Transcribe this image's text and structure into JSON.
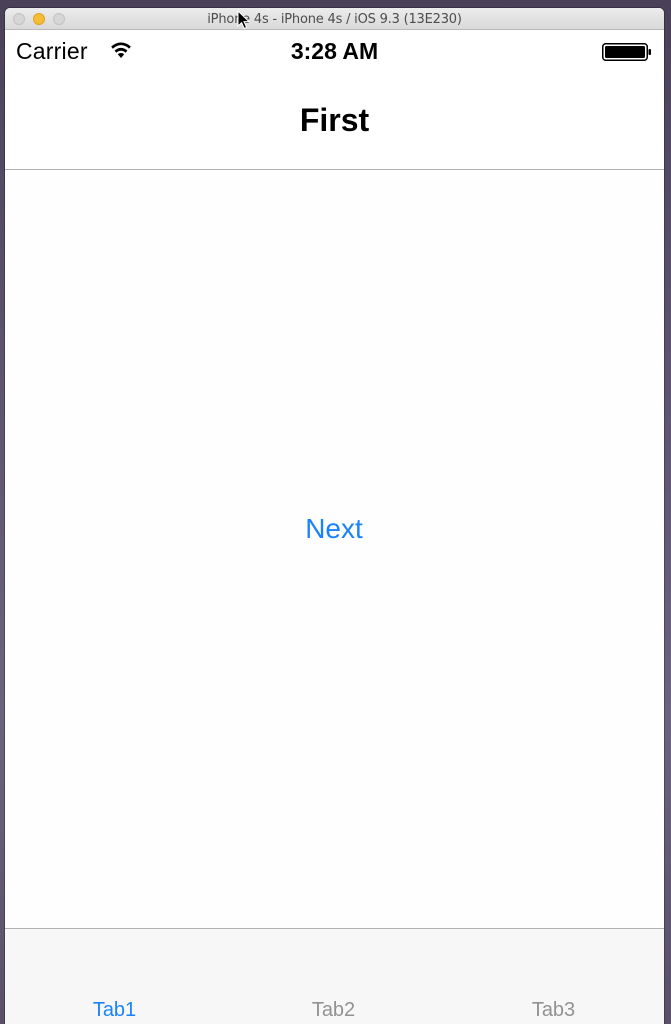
{
  "window": {
    "title": "iPhone 4s - iPhone 4s / iOS 9.3 (13E230)"
  },
  "statusbar": {
    "carrier": "Carrier",
    "time": "3:28 AM",
    "wifi_icon": "wifi-icon",
    "battery_icon": "battery-icon"
  },
  "navbar": {
    "title": "First"
  },
  "content": {
    "next_label": "Next"
  },
  "tabbar": {
    "tabs": [
      {
        "label": "Tab1",
        "selected": true
      },
      {
        "label": "Tab2",
        "selected": false
      },
      {
        "label": "Tab3",
        "selected": false
      }
    ]
  },
  "colors": {
    "accent": "#1a82fb",
    "tab_inactive": "#929292",
    "bar_border": "#b2b2b2",
    "minimize_button": "#f5bd35"
  }
}
